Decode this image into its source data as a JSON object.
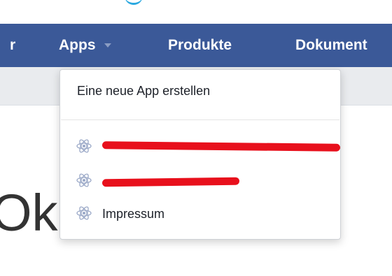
{
  "navbar": {
    "left_partial_label": "r",
    "items": [
      {
        "label": "Apps",
        "has_dropdown": true
      },
      {
        "label": "Produkte"
      },
      {
        "label": "Dokument"
      }
    ]
  },
  "apps_menu": {
    "create_label": "Eine neue App erstellen",
    "apps": [
      {
        "label": "",
        "icon": "react-atom-icon",
        "redacted": true
      },
      {
        "label": "",
        "icon": "react-atom-icon",
        "redacted": true
      },
      {
        "label": "Impressum",
        "icon": "react-atom-icon",
        "redacted": false
      }
    ]
  },
  "background": {
    "heading_partial": "Ok",
    "text_partial": ""
  },
  "colors": {
    "navbar": "#3b5998",
    "subbar": "#e9ebee",
    "redaction": "#e8101c",
    "icon": "#9aa8c7"
  }
}
